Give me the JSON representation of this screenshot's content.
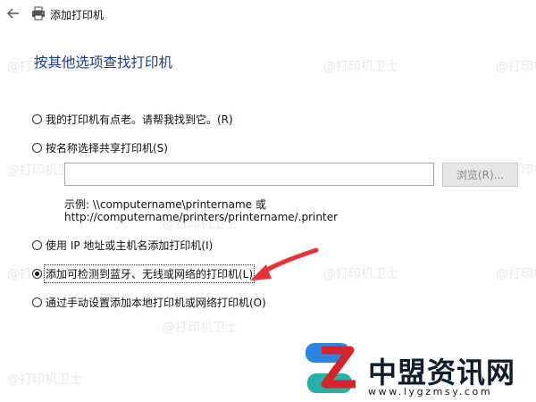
{
  "window": {
    "title": "添加打印机"
  },
  "heading": "按其他选项查找打印机",
  "options": [
    {
      "label": "我的打印机有点老。请帮我找到它。(R)",
      "checked": false
    },
    {
      "label": "按名称选择共享打印机(S)",
      "checked": false
    },
    {
      "label": "使用 IP 地址或主机名添加打印机(I)",
      "checked": false
    },
    {
      "label": "添加可检测到蓝牙、无线或网络的打印机(L)",
      "checked": true
    },
    {
      "label": "通过手动设置添加本地打印机或网络打印机(O)",
      "checked": false
    }
  ],
  "share_input": {
    "value": ""
  },
  "browse_button": "浏览(R)...",
  "example": {
    "line1": "示例: \\\\computername\\printername 或",
    "line2": "http://computername/printers/printername/.printer"
  },
  "watermark": "@打印机卫士",
  "logo": {
    "title": "中盟资讯网",
    "url": "www.lygzmsy.com"
  },
  "colors": {
    "heading": "#1e3c8c",
    "arrow": "#e8323a",
    "logo_blue": "#2a84e0"
  }
}
